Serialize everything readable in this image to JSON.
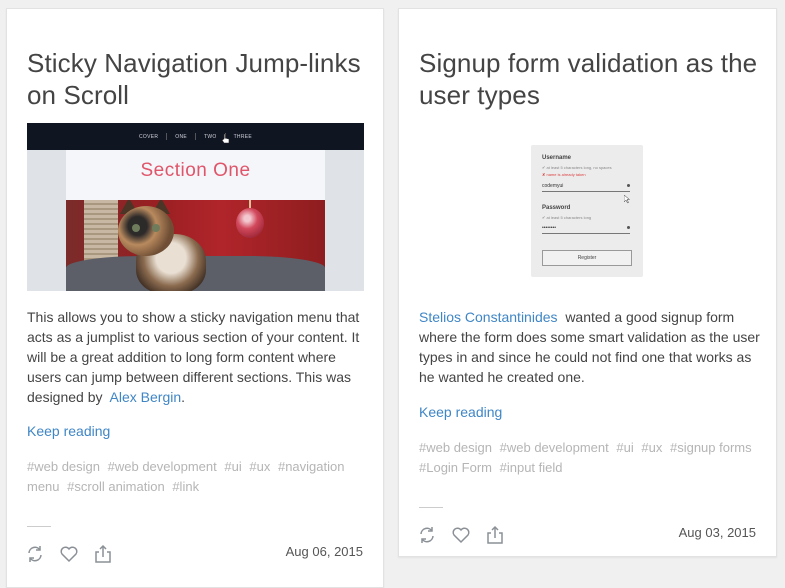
{
  "cards": [
    {
      "title": "Sticky Navigation Jump-links on Scroll",
      "description_prefix": "This allows you to show a sticky navigation menu that acts as a jumplist to various section of your content. It will be a great addition to long form content where users can jump between different sections. This was designed by",
      "author": "Alex Bergin",
      "description_suffix": ".",
      "keep_reading": "Keep reading",
      "tags": [
        "#web design",
        "#web development",
        "#ui",
        "#ux",
        "#navigation menu",
        "#scroll animation",
        "#link"
      ],
      "date": "Aug 06, 2015",
      "thumbnail": {
        "nav_items": [
          "COVER",
          "ONE",
          "TWO",
          "THREE"
        ],
        "section_title": "Section One"
      }
    },
    {
      "title": "Signup form validation as the user types",
      "author": "Stelios Constantinides",
      "description_suffix": "wanted a good signup form where the form does some smart validation as the user types in and since he could not find one that works as he wanted he created one.",
      "keep_reading": "Keep reading",
      "tags": [
        "#web design",
        "#web development",
        "#ui",
        "#ux",
        "#signup forms",
        "#Login Form",
        "#input field"
      ],
      "date": "Aug 03, 2015",
      "thumbnail": {
        "username_label": "Username",
        "username_hint": "✔ at least 5 characters long, no spaces",
        "username_error": "✘ name is already taken",
        "username_value": "codemyui",
        "password_label": "Password",
        "password_hint": "✔ at least 5 characters long",
        "password_value": "••••••••",
        "register_label": "Register"
      }
    }
  ],
  "icons": [
    "retweet-icon",
    "heart-icon",
    "share-icon"
  ],
  "colors": {
    "link": "#3f86c6",
    "tag": "#b5b5b5",
    "section_title": "#e0556a"
  }
}
